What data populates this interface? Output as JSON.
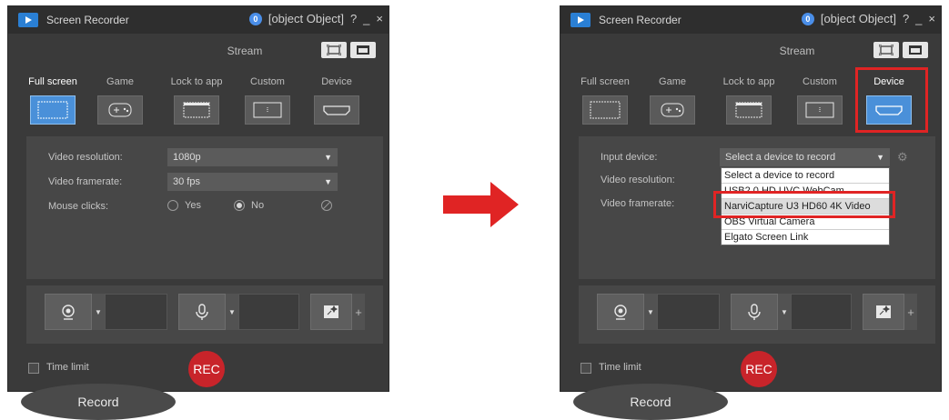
{
  "colors": {
    "window_bg": "#3a3a3a",
    "accent": "#4a90d9",
    "highlight": "#e02424",
    "rec": "#c8242a"
  },
  "left_window": {
    "title": "Screen Recorder",
    "badge": "0",
    "title_icons": [
      "help-icon",
      "minimize-icon",
      "close-icon"
    ],
    "help": "?",
    "minimize": "_",
    "close": "×",
    "settings": {
      "resolution_label": "Video resolution:",
      "resolution_value": "1080p",
      "framerate_label": "Video framerate:",
      "framerate_value": "30 fps",
      "mouse_label": "Mouse clicks:",
      "yes": "Yes",
      "no": "No",
      "selected": "No"
    },
    "tabs": {
      "record": "Record",
      "stream": "Stream"
    },
    "modes": [
      "Full screen",
      "Game",
      "Lock to app",
      "Custom",
      "Device"
    ],
    "active_mode": "Full screen",
    "time_limit": "Time limit",
    "rec": "REC"
  },
  "right_window": {
    "title": "Screen Recorder",
    "badge": "0",
    "help": "?",
    "minimize": "_",
    "close": "×",
    "settings": {
      "input_label": "Input device:",
      "input_value": "Select a device to record",
      "resolution_label": "Video resolution:",
      "framerate_label": "Video framerate:",
      "options": [
        "Select a device to record",
        "USB2.0 HD UVC WebCam",
        "NarviCapture U3 HD60 4K Video",
        "OBS Virtual Camera",
        "Elgato Screen Link"
      ],
      "highlighted_option": "NarviCapture U3 HD60 4K Video"
    },
    "tabs": {
      "record": "Record",
      "stream": "Stream"
    },
    "modes": [
      "Full screen",
      "Game",
      "Lock to app",
      "Custom",
      "Device"
    ],
    "active_mode": "Device",
    "time_limit": "Time limit",
    "rec": "REC"
  }
}
